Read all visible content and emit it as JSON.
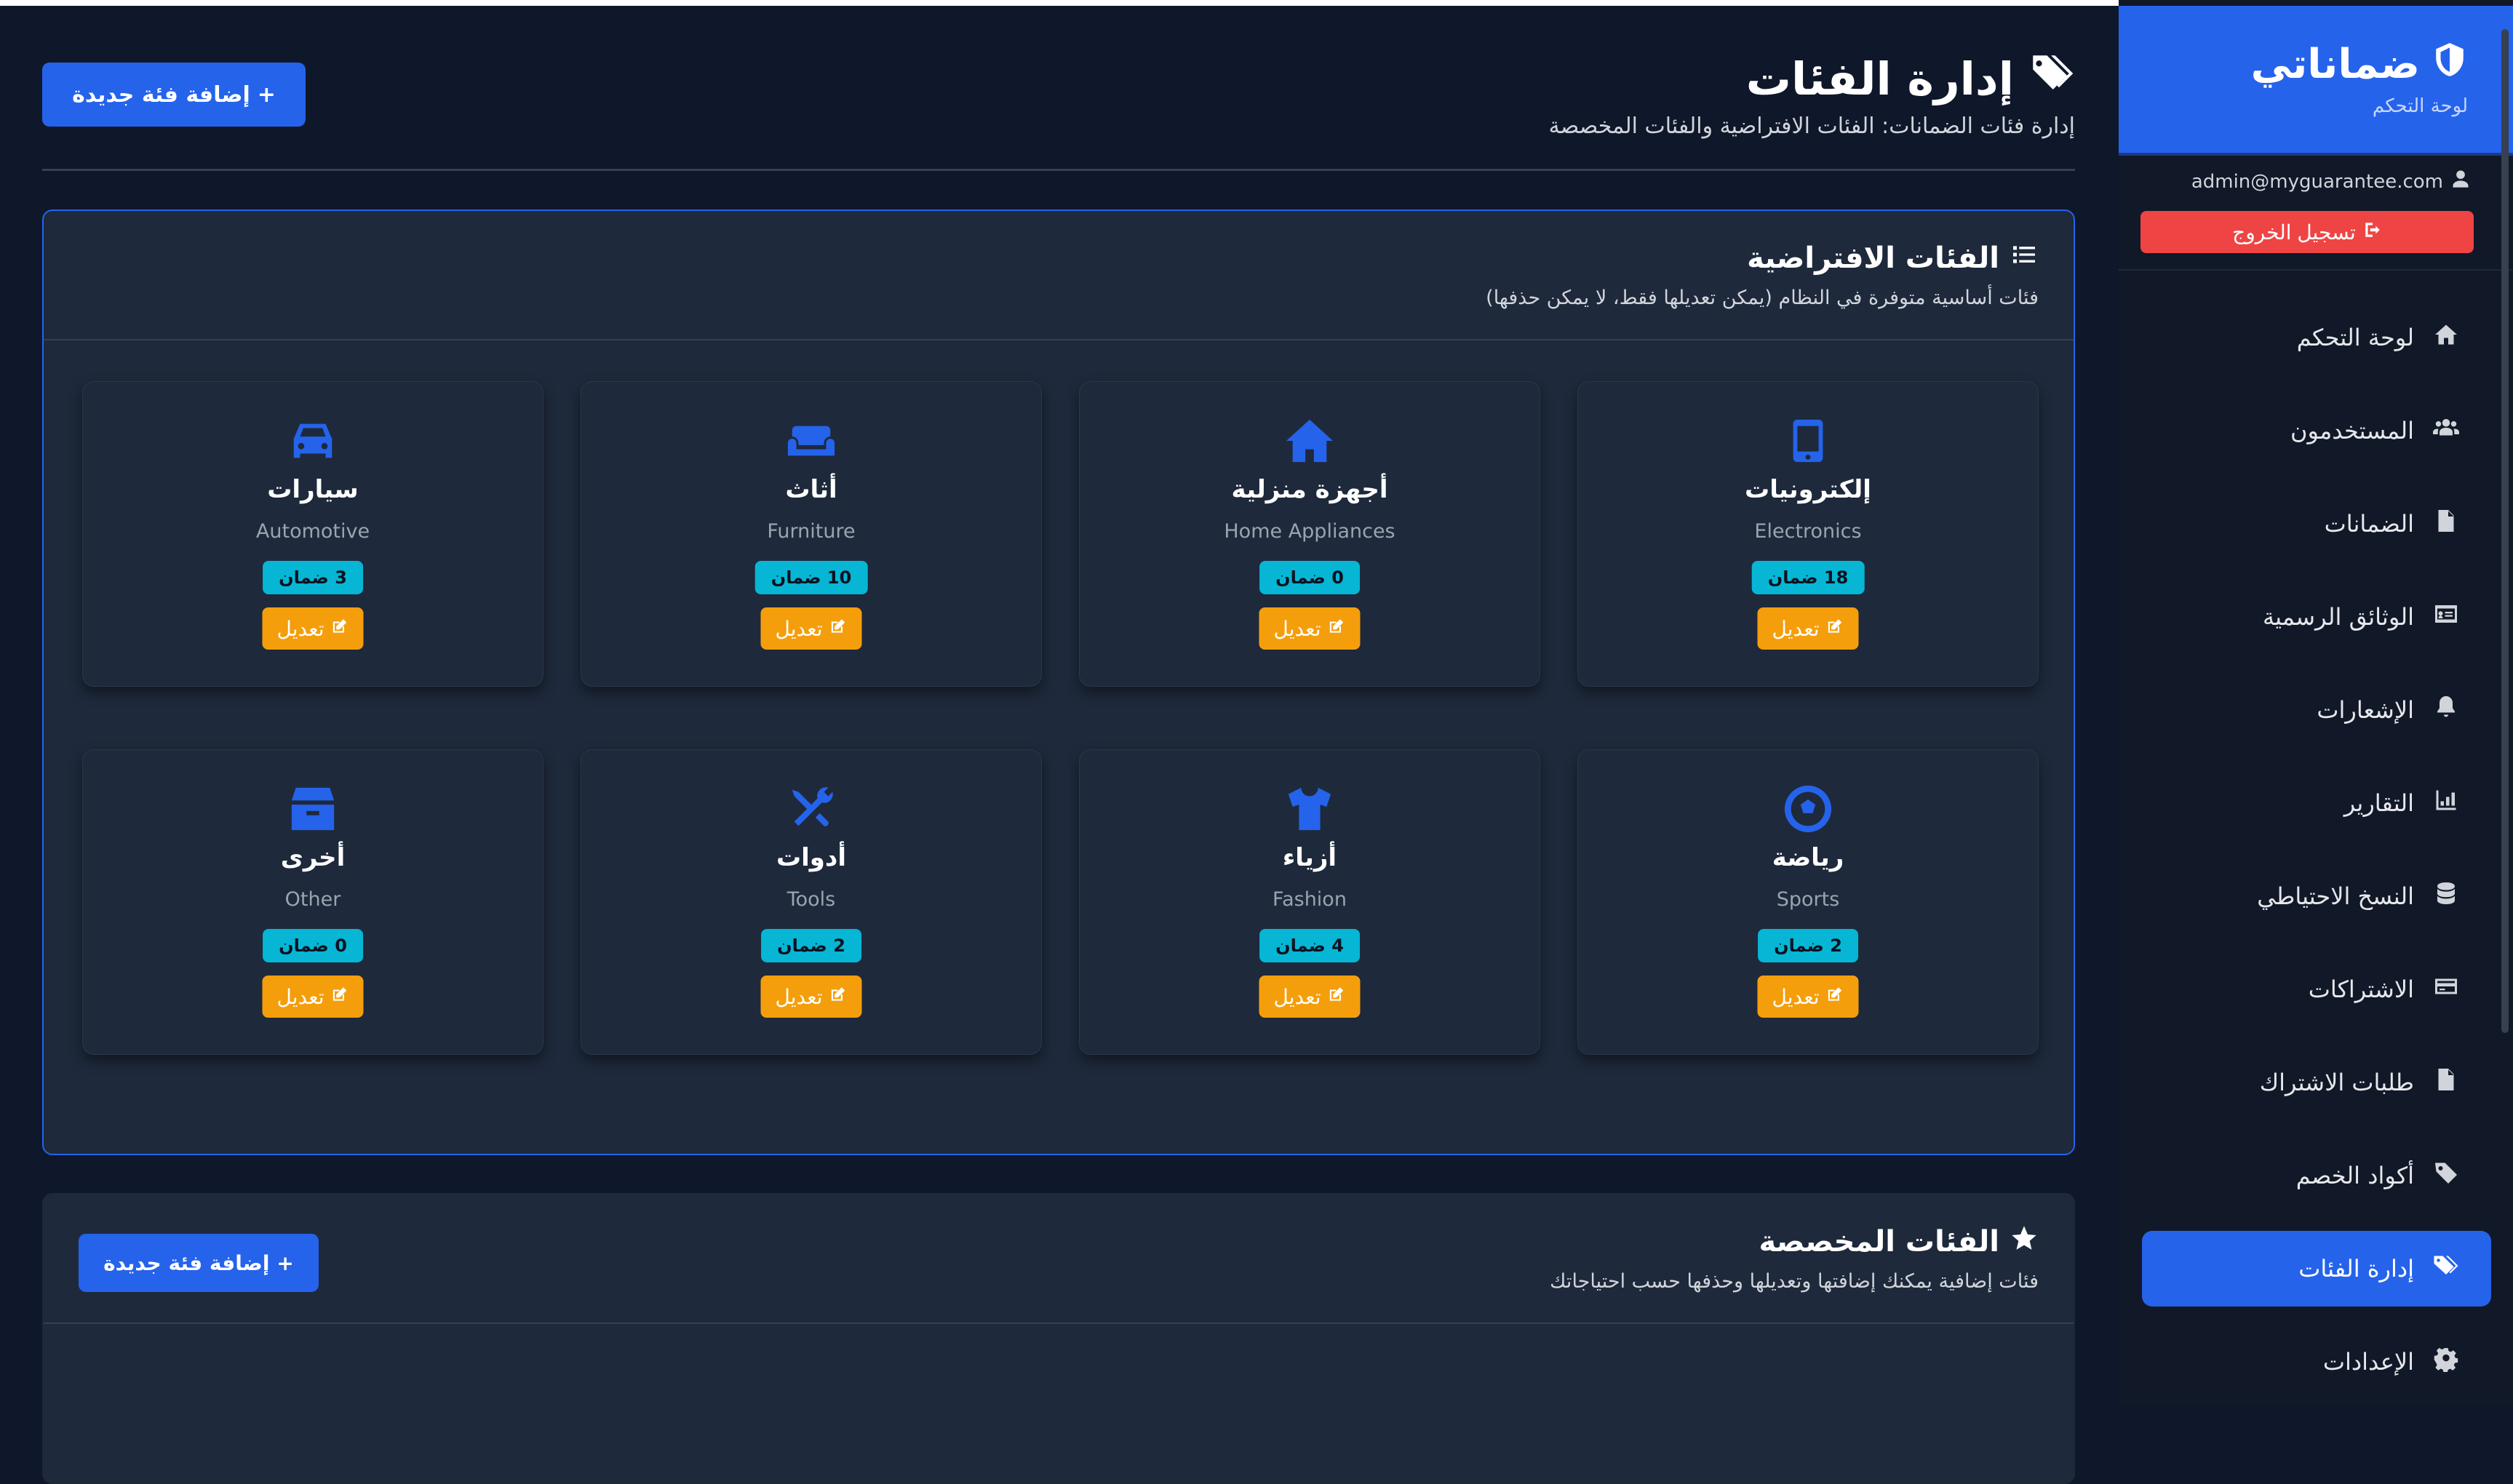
{
  "sidebar": {
    "brand": "ضماناتي",
    "subtitle": "لوحة التحكم",
    "user_email": "admin@myguarantee.com",
    "logout_label": "تسجيل الخروج",
    "items": [
      {
        "label": "لوحة التحكم",
        "icon": "home-icon"
      },
      {
        "label": "المستخدمون",
        "icon": "users-icon"
      },
      {
        "label": "الضمانات",
        "icon": "file-icon"
      },
      {
        "label": "الوثائق الرسمية",
        "icon": "id-card-icon"
      },
      {
        "label": "الإشعارات",
        "icon": "bell-icon"
      },
      {
        "label": "التقارير",
        "icon": "chart-icon"
      },
      {
        "label": "النسخ الاحتياطي",
        "icon": "database-icon"
      },
      {
        "label": "الاشتراكات",
        "icon": "credit-card-icon"
      },
      {
        "label": "طلبات الاشتراك",
        "icon": "invoice-icon"
      },
      {
        "label": "أكواد الخصم",
        "icon": "tag-icon"
      },
      {
        "label": "إدارة الفئات",
        "icon": "tags-icon",
        "active": true
      },
      {
        "label": "الإعدادات",
        "icon": "gear-icon"
      }
    ]
  },
  "header": {
    "title": "إدارة الفئات",
    "subtitle": "إدارة فئات الضمانات: الفئات الافتراضية والفئات المخصصة",
    "add_label": "إضافة فئة جديدة"
  },
  "default_section": {
    "title": "الفئات الافتراضية",
    "desc": "فئات أساسية متوفرة في النظام (يمكن تعديلها فقط، لا يمكن حذفها)"
  },
  "custom_section": {
    "title": "الفئات المخصصة",
    "desc": "فئات إضافية يمكنك إضافتها وتعديلها وحذفها حسب احتياجاتك",
    "add_label": "إضافة فئة جديدة"
  },
  "edit_label": "تعديل",
  "categories": [
    {
      "name": "إلكترونيات",
      "en": "Electronics",
      "count": "18 ضمان",
      "icon": "mobile-icon"
    },
    {
      "name": "أجهزة منزلية",
      "en": "Home Appliances",
      "count": "0 ضمان",
      "icon": "house-icon"
    },
    {
      "name": "أثاث",
      "en": "Furniture",
      "count": "10 ضمان",
      "icon": "couch-icon"
    },
    {
      "name": "سيارات",
      "en": "Automotive",
      "count": "3 ضمان",
      "icon": "car-icon"
    },
    {
      "name": "رياضة",
      "en": "Sports",
      "count": "2 ضمان",
      "icon": "football-icon"
    },
    {
      "name": "أزياء",
      "en": "Fashion",
      "count": "4 ضمان",
      "icon": "shirt-icon"
    },
    {
      "name": "أدوات",
      "en": "Tools",
      "count": "2 ضمان",
      "icon": "tools-icon"
    },
    {
      "name": "أخرى",
      "en": "Other",
      "count": "0 ضمان",
      "icon": "box-icon"
    }
  ],
  "colors": {
    "primary": "#2563eb",
    "danger": "#ef4444",
    "badge": "#06b6d4",
    "warning": "#f59e0b",
    "background": "#0f172a",
    "panel": "#1e293b"
  }
}
